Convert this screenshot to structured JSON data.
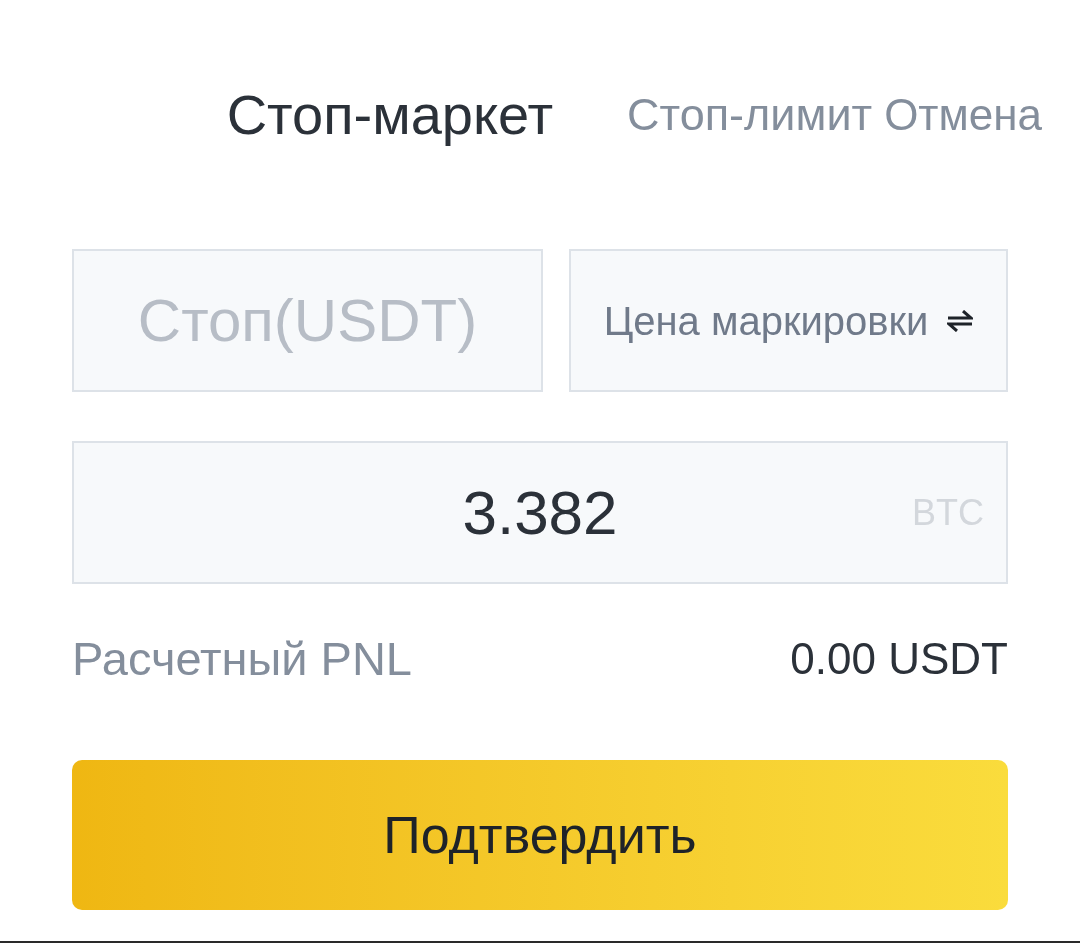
{
  "tabs": [
    {
      "label": "Стоп-маркет",
      "selected": true
    },
    {
      "label": "Стоп-лимит",
      "selected": false
    }
  ],
  "cancel_button": {
    "label": "Отмена"
  },
  "stop_field": {
    "placeholder": "Стоп(USDT)"
  },
  "trigger_select": {
    "label": "Цена маркировки"
  },
  "amount_field": {
    "value": "3.382",
    "unit": "BTC"
  },
  "pnl": {
    "label": "Расчетный PNL",
    "value": "0.00 USDT"
  },
  "confirm_button": {
    "label": "Подтвердить"
  }
}
